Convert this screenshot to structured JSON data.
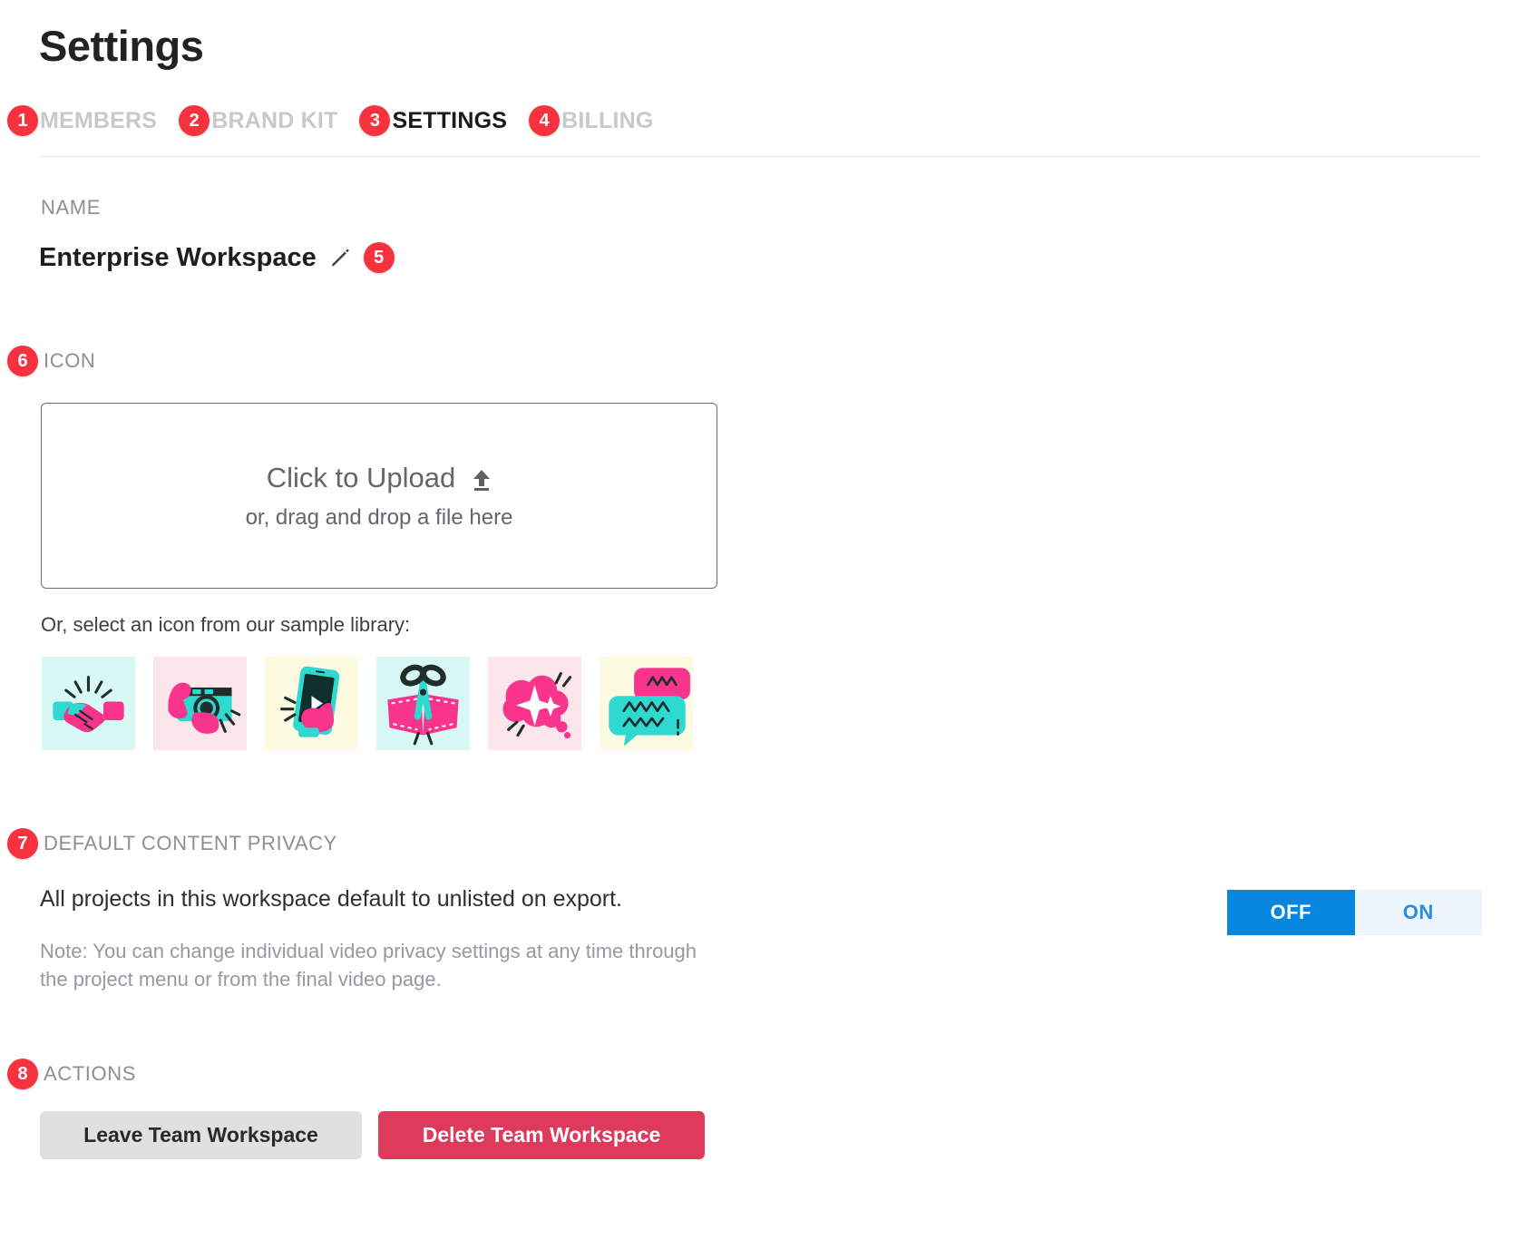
{
  "page": {
    "title": "Settings"
  },
  "tabs": [
    {
      "marker": "1",
      "label": "MEMBERS",
      "active": false
    },
    {
      "marker": "2",
      "label": "BRAND KIT",
      "active": false
    },
    {
      "marker": "3",
      "label": "SETTINGS",
      "active": true
    },
    {
      "marker": "4",
      "label": "BILLING",
      "active": false
    }
  ],
  "name_section": {
    "label": "NAME",
    "value": "Enterprise Workspace",
    "edit_icon": "pencil-icon",
    "edit_marker": "5"
  },
  "icon_section": {
    "marker": "6",
    "label": "ICON",
    "upload": {
      "primary_text": "Click to Upload",
      "icon": "upload-arrow-icon",
      "secondary_text": "or, drag and drop a file here"
    },
    "sample_label": "Or, select an icon from our sample library:",
    "samples": [
      {
        "name": "handshake-icon",
        "bg": "#D7F8F4"
      },
      {
        "name": "camera-hands-icon",
        "bg": "#FDE5EC"
      },
      {
        "name": "phone-play-icon",
        "bg": "#FCFBE2"
      },
      {
        "name": "scissors-cut-icon",
        "bg": "#D7F8F4"
      },
      {
        "name": "thought-bubble-sparkle-icon",
        "bg": "#FDE5EC"
      },
      {
        "name": "speech-bubbles-icon",
        "bg": "#FCFBE2"
      }
    ]
  },
  "privacy_section": {
    "marker": "7",
    "label": "DEFAULT CONTENT PRIVACY",
    "description": "All projects in this workspace default to unlisted on export.",
    "note": "Note: You can change individual video privacy settings at any time through the project menu or from the final video page.",
    "toggle": {
      "off_label": "OFF",
      "on_label": "ON",
      "selected": "OFF",
      "selected_bg": "#0786E0",
      "unselected_bg": "#EDF5FD",
      "unselected_fg": "#2A8BE3"
    }
  },
  "actions_section": {
    "marker": "8",
    "label": "ACTIONS",
    "leave_button": "Leave Team Workspace",
    "delete_button": "Delete Team Workspace",
    "delete_color": "#DE3A5C"
  },
  "colors": {
    "marker_red": "#F6323E",
    "title_color": "#222222",
    "muted": "#8c8f95"
  }
}
